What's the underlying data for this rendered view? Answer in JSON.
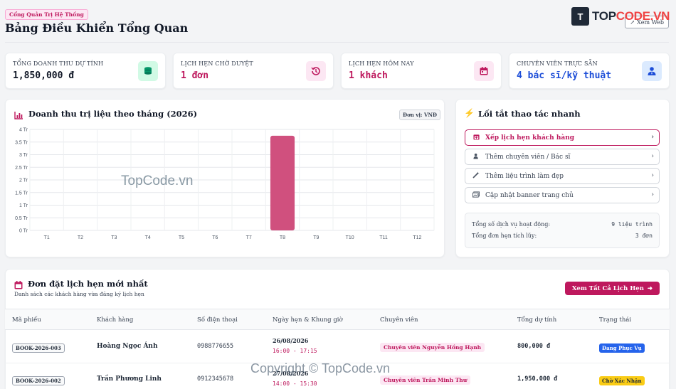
{
  "colors": {
    "accent": "#be185d",
    "green": "#059669",
    "blue": "#1d4ed8",
    "chart_bar": "#d0507e"
  },
  "header": {
    "portal_badge": "Cổng Quản Trị Hệ Thống",
    "title": "Bảng Điều Khiển Tổng Quan",
    "view_web": "Xem Web",
    "logo_prefix": "TOP",
    "logo_suffix": "CODE.VN",
    "logo_mark": "T"
  },
  "stats": [
    {
      "label": "TỔNG DOANH THU DỰ TÍNH",
      "value": "1,850,000 đ",
      "icon": "money-stack-icon",
      "color": "#111827",
      "bg": "#d1fae5",
      "icon_color": "#059669"
    },
    {
      "label": "LỊCH HẸN CHỜ DUYỆT",
      "value": "1 đơn",
      "icon": "history-icon",
      "color": "#be185d",
      "bg": "#fce7f3",
      "icon_color": "#be185d"
    },
    {
      "label": "LỊCH HẸN HÔM NAY",
      "value": "1 khách",
      "icon": "calendar-icon",
      "color": "#be185d",
      "bg": "#fce7f3",
      "icon_color": "#be185d"
    },
    {
      "label": "CHUYÊN VIÊN TRỰC SẴN",
      "value": "4 bác sĩ/kỹ thuật",
      "icon": "user-tie-icon",
      "color": "#1d4ed8",
      "bg": "#dbeafe",
      "icon_color": "#1d4ed8"
    }
  ],
  "revenue": {
    "title": "Doanh thu trị liệu theo tháng (2026)",
    "unit_badge": "Đơn vị: VNĐ"
  },
  "chart_data": {
    "type": "bar",
    "title": "Doanh thu trị liệu theo tháng (2026)",
    "categories": [
      "T1",
      "T2",
      "T3",
      "T4",
      "T5",
      "T6",
      "T7",
      "T8",
      "T9",
      "T10",
      "T11",
      "T12"
    ],
    "values": [
      0,
      0,
      0,
      0,
      0,
      0,
      0,
      3.75,
      0,
      0,
      0,
      0
    ],
    "ylim": [
      0,
      4
    ],
    "yticks": [
      "0 Tr",
      "0.5 Tr",
      "1 Tr",
      "1.5 Tr",
      "2 Tr",
      "2.5 Tr",
      "3 Tr",
      "3.5 Tr",
      "4 Tr"
    ],
    "grid": true,
    "legend": "none"
  },
  "watermarks": {
    "mid": "TopCode.vn",
    "bottom": "Copyright © TopCode.vn"
  },
  "quick_actions": {
    "title": "Lối tắt thao tác nhanh",
    "items": [
      {
        "label": "Xếp lịch hẹn khách hàng",
        "icon": "calendar-plus-icon"
      },
      {
        "label": "Thêm chuyên viên / Bác sĩ",
        "icon": "user-plus-icon"
      },
      {
        "label": "Thêm liệu trình làm đẹp",
        "icon": "magic-wand-icon"
      },
      {
        "label": "Cập nhật banner trang chủ",
        "icon": "image-icon"
      }
    ],
    "summary": [
      {
        "label": "Tổng số dịch vụ hoạt động:",
        "value": "9 liệu trình"
      },
      {
        "label": "Tổng đơn hẹn tích lũy:",
        "value": "3 đơn"
      }
    ]
  },
  "bookings": {
    "title": "Đơn đặt lịch hẹn mới nhất",
    "subtitle": "Danh sách các khách hàng vừa đăng ký lịch hẹn",
    "view_all": "Xem Tất Cả Lịch Hẹn",
    "headers": [
      "Mã phiếu",
      "Khách hàng",
      "Số điện thoại",
      "Ngày hẹn & Khung giờ",
      "Chuyên viên",
      "Tổng dự tính",
      "Trạng thái"
    ],
    "rows": [
      {
        "code": "BOOK-2026-003",
        "customer": "Hoàng Ngọc Ánh",
        "phone": "0988776655",
        "date": "26/08/2026",
        "time": "16:00 - 17:15",
        "specialist": "Chuyên viên Nguyễn Hồng Hạnh",
        "total": "800,000 đ",
        "status": "Đang Phục Vụ",
        "status_bg": "#2563eb",
        "status_fg": "#ffffff"
      },
      {
        "code": "BOOK-2026-002",
        "customer": "Trần Phương Linh",
        "phone": "0912345678",
        "date": "27/08/2026",
        "time": "14:00 - 15:30",
        "specialist": "Chuyên viên Trần Minh Thư",
        "total": "1,950,000 đ",
        "status": "Chờ Xác Nhận",
        "status_bg": "#facc15",
        "status_fg": "#1f2937"
      }
    ]
  }
}
